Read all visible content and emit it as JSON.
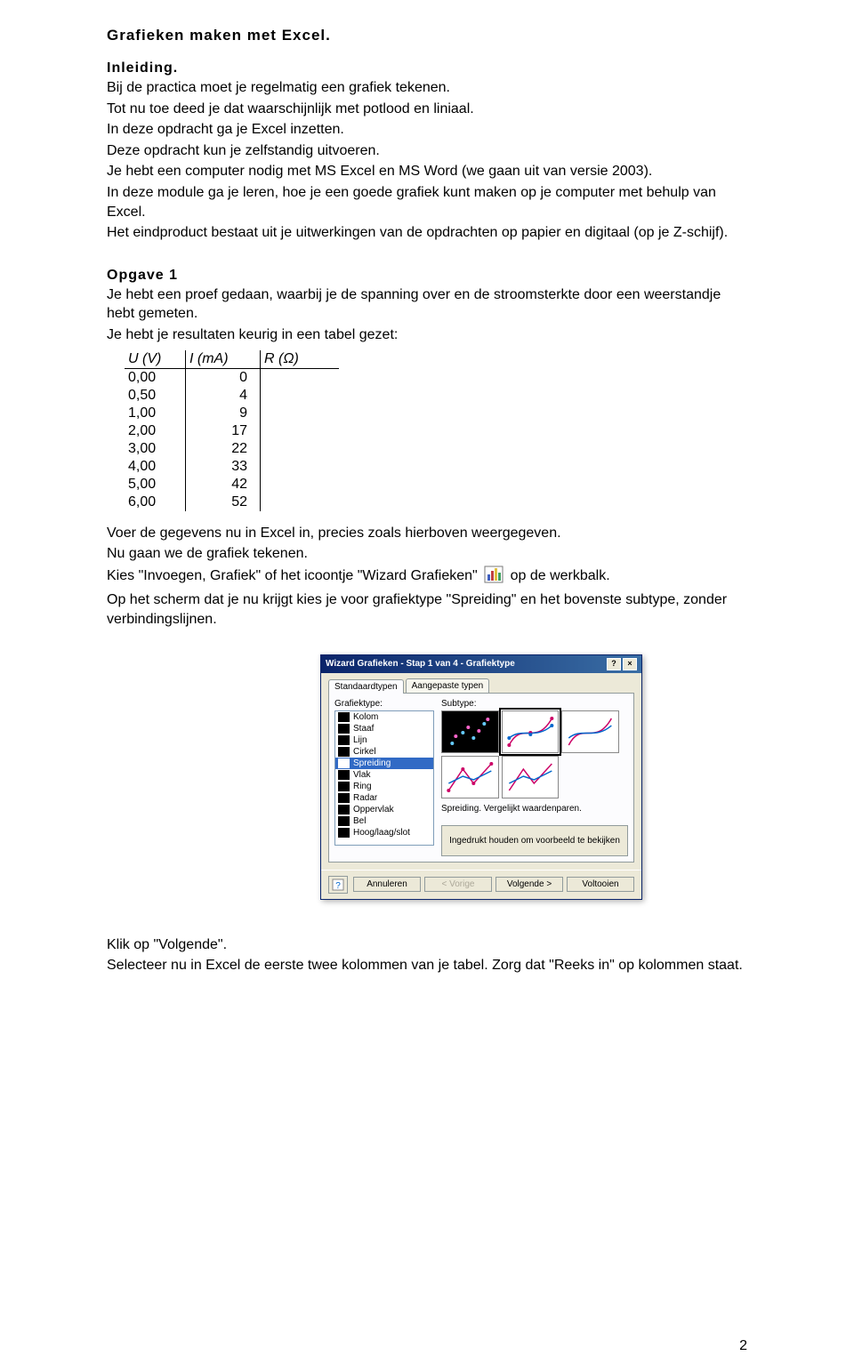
{
  "title": "Grafieken maken met Excel.",
  "intro": {
    "heading": "Inleiding.",
    "lines": [
      "Bij de practica moet je regelmatig een grafiek tekenen.",
      "Tot nu toe deed je dat waarschijnlijk met potlood en liniaal.",
      "In deze opdracht ga je Excel inzetten.",
      "Deze opdracht kun je zelfstandig uitvoeren.",
      "Je hebt een computer nodig met MS Excel en MS Word (we gaan uit van versie 2003).",
      "In deze module ga je leren, hoe je een goede grafiek kunt maken op je computer met behulp van Excel.",
      "Het eindproduct bestaat uit je uitwerkingen van de opdrachten op papier en digitaal (op je Z-schijf)."
    ]
  },
  "opgave": {
    "heading": "Opgave 1",
    "p1": "Je hebt een proef gedaan, waarbij je de spanning over en de stroomsterkte door een weerstandje hebt gemeten.",
    "p2": "Je hebt je resultaten keurig in een tabel gezet:"
  },
  "table": {
    "headers": [
      "U (V)",
      "I (mA)",
      "R (Ω)"
    ],
    "rows": [
      [
        "0,00",
        "0",
        ""
      ],
      [
        "0,50",
        "4",
        ""
      ],
      [
        "1,00",
        "9",
        ""
      ],
      [
        "2,00",
        "17",
        ""
      ],
      [
        "3,00",
        "22",
        ""
      ],
      [
        "4,00",
        "33",
        ""
      ],
      [
        "5,00",
        "42",
        ""
      ],
      [
        "6,00",
        "52",
        ""
      ]
    ]
  },
  "after_table": {
    "l1": "Voer de gegevens nu in Excel in, precies zoals hierboven weergegeven.",
    "l2": "Nu gaan we de grafiek tekenen.",
    "l3a": "Kies \"Invoegen, Grafiek\" of het icoontje \"Wizard Grafieken\"",
    "l3b": "op de werkbalk.",
    "l4": "Op het scherm dat je nu krijgt kies je voor grafiektype \"Spreiding\" en het bovenste subtype, zonder verbindingslijnen."
  },
  "wizard": {
    "title": "Wizard Grafieken - Stap 1 van 4 - Grafiektype",
    "tabs": [
      "Standaardtypen",
      "Aangepaste typen"
    ],
    "chart_type_label": "Grafiektype:",
    "subtype_label": "Subtype:",
    "types": [
      "Kolom",
      "Staaf",
      "Lijn",
      "Cirkel",
      "Spreiding",
      "Vlak",
      "Ring",
      "Radar",
      "Oppervlak",
      "Bel",
      "Hoog/laag/slot"
    ],
    "selected_type_index": 4,
    "subtype_desc": "Spreiding. Vergelijkt waardenparen.",
    "preview_btn": "Ingedrukt houden om voorbeeld te bekijken",
    "buttons": {
      "cancel": "Annuleren",
      "back": "< Vorige",
      "next": "Volgende >",
      "finish": "Voltooien"
    }
  },
  "outro": {
    "l1": "Klik op \"Volgende\".",
    "l2": "Selecteer nu in Excel de eerste twee kolommen van je tabel. Zorg dat \"Reeks in\" op kolommen staat."
  },
  "page_number": "2"
}
